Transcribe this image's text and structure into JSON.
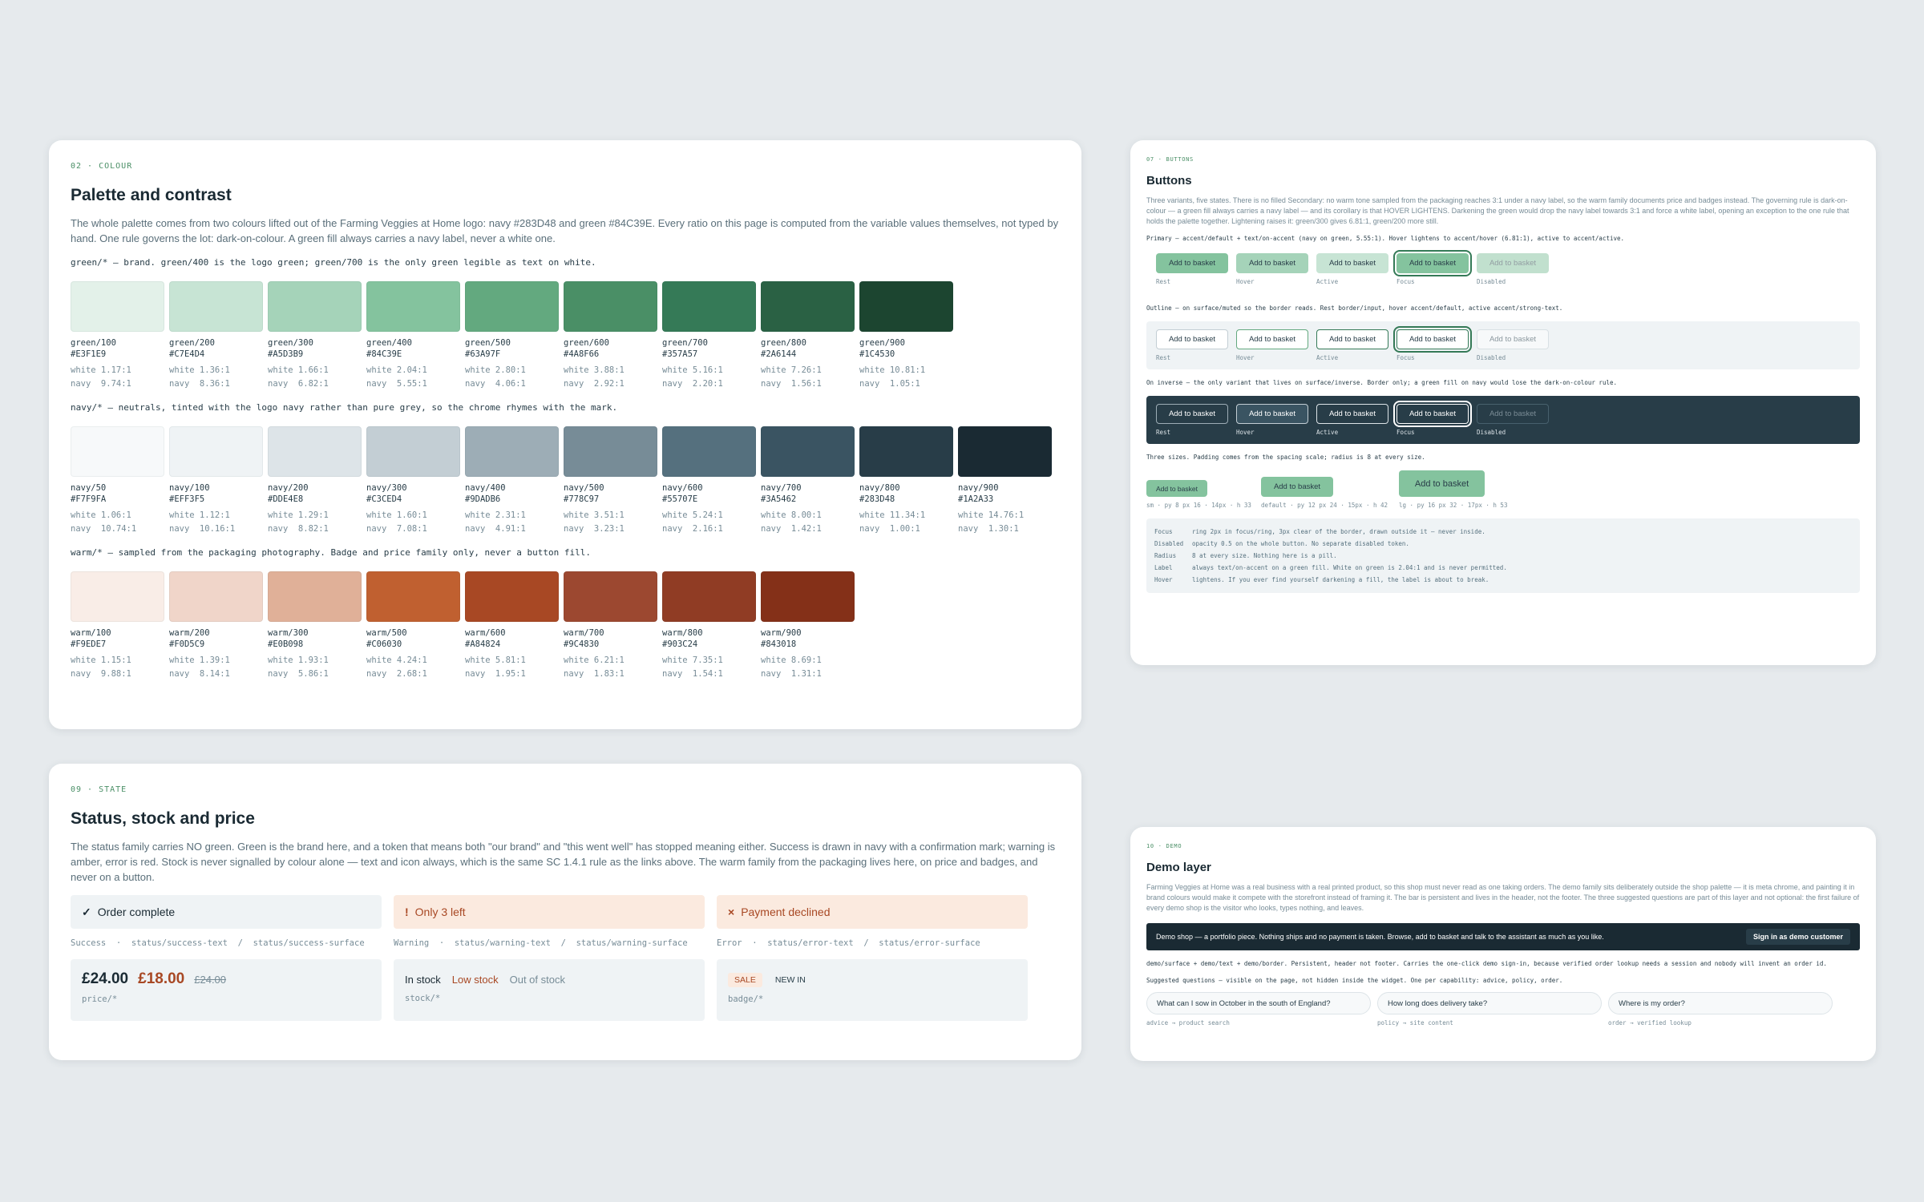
{
  "palette": {
    "eyebrow": "02 · COLOUR",
    "title": "Palette and contrast",
    "lead": "The whole palette comes from two colours lifted out of the Farming Veggies at Home logo: navy #283D48 and green #84C39E. Every ratio on this page is computed from the variable values themselves, not typed by hand. One rule governs the lot: dark-on-colour. A green fill always carries a navy label, never a white one.",
    "families": [
      {
        "title": "green/* — brand. green/400 is the logo green; green/700 is the only green legible as text on white.",
        "swatches": [
          {
            "name": "green/100",
            "hex": "#E3F1E9",
            "white": "white 1.17:1",
            "navy": "navy  9.74:1"
          },
          {
            "name": "green/200",
            "hex": "#C7E4D4",
            "white": "white 1.36:1",
            "navy": "navy  8.36:1"
          },
          {
            "name": "green/300",
            "hex": "#A5D3B9",
            "white": "white 1.66:1",
            "navy": "navy  6.82:1"
          },
          {
            "name": "green/400",
            "hex": "#84C39E",
            "white": "white 2.04:1",
            "navy": "navy  5.55:1"
          },
          {
            "name": "green/500",
            "hex": "#63A97F",
            "white": "white 2.80:1",
            "navy": "navy  4.06:1"
          },
          {
            "name": "green/600",
            "hex": "#4A8F66",
            "white": "white 3.88:1",
            "navy": "navy  2.92:1"
          },
          {
            "name": "green/700",
            "hex": "#357A57",
            "white": "white 5.16:1",
            "navy": "navy  2.20:1"
          },
          {
            "name": "green/800",
            "hex": "#2A6144",
            "white": "white 7.26:1",
            "navy": "navy  1.56:1"
          },
          {
            "name": "green/900",
            "hex": "#1C4530",
            "white": "white 10.81:1",
            "navy": "navy  1.05:1"
          }
        ]
      },
      {
        "title": "navy/* — neutrals, tinted with the logo navy rather than pure grey, so the chrome rhymes with the mark.",
        "swatches": [
          {
            "name": "navy/50",
            "hex": "#F7F9FA",
            "white": "white 1.06:1",
            "navy": "navy  10.74:1"
          },
          {
            "name": "navy/100",
            "hex": "#EFF3F5",
            "white": "white 1.12:1",
            "navy": "navy  10.16:1"
          },
          {
            "name": "navy/200",
            "hex": "#DDE4E8",
            "white": "white 1.29:1",
            "navy": "navy  8.82:1"
          },
          {
            "name": "navy/300",
            "hex": "#C3CED4",
            "white": "white 1.60:1",
            "navy": "navy  7.08:1"
          },
          {
            "name": "navy/400",
            "hex": "#9DADB6",
            "white": "white 2.31:1",
            "navy": "navy  4.91:1"
          },
          {
            "name": "navy/500",
            "hex": "#778C97",
            "white": "white 3.51:1",
            "navy": "navy  3.23:1"
          },
          {
            "name": "navy/600",
            "hex": "#55707E",
            "white": "white 5.24:1",
            "navy": "navy  2.16:1"
          },
          {
            "name": "navy/700",
            "hex": "#3A5462",
            "white": "white 8.00:1",
            "navy": "navy  1.42:1"
          },
          {
            "name": "navy/800",
            "hex": "#283D48",
            "white": "white 11.34:1",
            "navy": "navy  1.00:1"
          },
          {
            "name": "navy/900",
            "hex": "#1A2A33",
            "white": "white 14.76:1",
            "navy": "navy  1.30:1"
          }
        ]
      },
      {
        "title": "warm/* — sampled from the packaging photography. Badge and price family only, never a button fill.",
        "swatches": [
          {
            "name": "warm/100",
            "hex": "#F9EDE7",
            "white": "white 1.15:1",
            "navy": "navy  9.88:1"
          },
          {
            "name": "warm/200",
            "hex": "#F0D5C9",
            "white": "white 1.39:1",
            "navy": "navy  8.14:1"
          },
          {
            "name": "warm/300",
            "hex": "#E0B098",
            "white": "white 1.93:1",
            "navy": "navy  5.86:1"
          },
          {
            "name": "warm/500",
            "hex": "#C06030",
            "white": "white 4.24:1",
            "navy": "navy  2.68:1"
          },
          {
            "name": "warm/600",
            "hex": "#A84824",
            "white": "white 5.81:1",
            "navy": "navy  1.95:1"
          },
          {
            "name": "warm/700",
            "hex": "#9C4830",
            "white": "white 6.21:1",
            "navy": "navy  1.83:1"
          },
          {
            "name": "warm/800",
            "hex": "#903C24",
            "white": "white 7.35:1",
            "navy": "navy  1.54:1"
          },
          {
            "name": "warm/900",
            "hex": "#843018",
            "white": "white 8.69:1",
            "navy": "navy  1.31:1"
          }
        ]
      }
    ]
  },
  "buttons": {
    "eyebrow": "07 · BUTTONS",
    "title": "Buttons",
    "lead": "Three variants, five states. There is no filled Secondary: no warm tone sampled from the packaging reaches 3:1 under a navy label, so the warm family documents price and badges instead. The governing rule is dark-on-colour — a green fill always carries a navy label — and its corollary is that HOVER LIGHTENS. Darkening the green would drop the navy label towards 3:1 and force a white label, opening an exception to the one rule that holds the palette together. Lightening raises it: green/300 gives 6.81:1, green/200 more still.",
    "primary_rule": "Primary — accent/default + text/on-accent (navy on green, 5.55:1). Hover lightens to accent/hover (6.81:1), active to accent/active.",
    "outline_rule": "Outline — on surface/muted so the border reads. Rest border/input, hover accent/default, active accent/strong-text.",
    "inverse_rule": "On inverse — the only variant that lives on surface/inverse. Border only; a green fill on navy would lose the dark-on-colour rule.",
    "sizes_rule": "Three sizes. Padding comes from the spacing scale; radius is 8 at every size.",
    "button_label": "Add to basket",
    "states": [
      "Rest",
      "Hover",
      "Active",
      "Focus",
      "Disabled"
    ],
    "sizes": [
      {
        "label": "Add to basket",
        "spec": "sm · py 8 px 16 · 14px · h 33"
      },
      {
        "label": "Add to basket",
        "spec": "default · py 12 px 24 · 15px · h 42"
      },
      {
        "label": "Add to basket",
        "spec": "lg · py 16 px 32 · 17px · h 53"
      }
    ],
    "specs": [
      {
        "k": "Focus",
        "v": "ring 2px in focus/ring, 3px clear of the border, drawn outside it — never inside."
      },
      {
        "k": "Disabled",
        "v": "opacity 0.5 on the whole button. No separate disabled token."
      },
      {
        "k": "Radius",
        "v": "8 at every size. Nothing here is a pill."
      },
      {
        "k": "Label",
        "v": "always text/on-accent on a green fill. White on green is 2.04:1 and is never permitted."
      },
      {
        "k": "Hover",
        "v": "lightens. If you ever find yourself darkening a fill, the label is about to break."
      }
    ]
  },
  "state": {
    "eyebrow": "09 · STATE",
    "title": "Status, stock and price",
    "lead": "The status family carries NO green. Green is the brand here, and a token that means both \"our brand\" and \"this went well\" has stopped meaning either. Success is drawn in navy with a confirmation mark; warning is amber, error is red. Stock is never signalled by colour alone — text and icon always, which is the same SC 1.4.1 rule as the links above. The warm family from the packaging lives here, on price and badges, and never on a button.",
    "success": {
      "mark": "✓",
      "text": "Order complete",
      "tokens": "Success  ·  status/success-text  /  status/success-surface"
    },
    "warning": {
      "mark": "!",
      "text": "Only 3 left",
      "tokens": "Warning  ·  status/warning-text  /  status/warning-surface"
    },
    "error": {
      "mark": "×",
      "text": "Payment declined",
      "tokens": "Error  ·  status/error-text  /  status/error-surface"
    },
    "price": {
      "now": "£24.00",
      "sale": "£18.00",
      "was": "£24.00",
      "label": "price/*"
    },
    "stock": {
      "in": "In stock",
      "low": "Low stock",
      "out": "Out of stock",
      "label": "stock/*"
    },
    "badge": {
      "sale": "SALE",
      "new": "NEW IN",
      "label": "badge/*"
    }
  },
  "demo": {
    "eyebrow": "10 · DEMO",
    "title": "Demo layer",
    "lead": "Farming Veggies at Home was a real business with a real printed product, so this shop must never read as one taking orders. The demo family sits deliberately outside the shop palette — it is meta chrome, and painting it in brand colours would make it compete with the storefront instead of framing it. The bar is persistent and lives in the header, not the footer. The three suggested questions are part of this layer and not optional: the first failure of every demo shop is the visitor who looks, types nothing, and leaves.",
    "bar_text": "Demo shop — a portfolio piece. Nothing ships and no payment is taken. Browse, add to basket and talk to the assistant as much as you like.",
    "signin": "Sign in as demo customer",
    "bar_rule": "demo/surface + demo/text + demo/border. Persistent, header not footer. Carries the one-click demo sign-in, because verified order lookup needs a session and nobody will invent an order id.",
    "questions_rule": "Suggested questions — visible on the page, not hidden inside the widget. One per capability: advice, policy, order.",
    "questions": [
      {
        "q": "What can I sow in October in the south of England?",
        "cap": "advice → product search"
      },
      {
        "q": "How long does delivery take?",
        "cap": "policy → site content"
      },
      {
        "q": "Where is my order?",
        "cap": "order → verified lookup"
      }
    ]
  }
}
